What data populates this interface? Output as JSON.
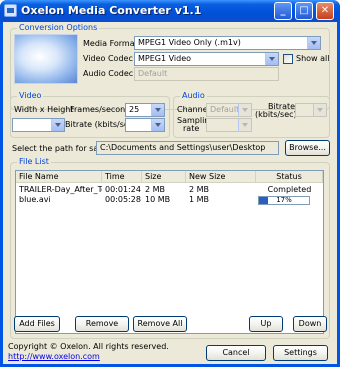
{
  "window": {
    "title": "Oxelon Media Converter v1.1"
  },
  "titlebar_buttons": {
    "minimize": "_",
    "maximize": "□",
    "close": "✕"
  },
  "conversion": {
    "title": "Conversion Options",
    "media_format_label": "Media Format",
    "media_format_value": "MPEG1 Video Only (.m1v)",
    "video_codec_label": "Video Codec",
    "video_codec_value": "MPEG1 Video",
    "show_all_label": "Show all",
    "audio_codec_label": "Audio Codec",
    "audio_codec_value": "Default"
  },
  "video": {
    "title": "Video",
    "width_height_label": "Width x Height",
    "width_height_value": "",
    "fps_label": "Frames/second",
    "fps_value": "25",
    "bitrate_label": "Bitrate (kbits/sec)",
    "bitrate_value": ""
  },
  "audio": {
    "title": "Audio",
    "channels_label": "Channels",
    "channels_value": "Default",
    "bitrate_label_1": "Bitrate",
    "bitrate_label_2": "(kbits/sec)",
    "bitrate_value": "",
    "sampling_label_1": "Sampling",
    "sampling_label_2": "rate",
    "sampling_value": ""
  },
  "save": {
    "label": "Select the path for saving:",
    "path": "C:\\Documents and Settings\\user\\Desktop",
    "browse_label": "Browse..."
  },
  "files": {
    "title": "File List",
    "columns": [
      "File Name",
      "Time",
      "Size",
      "New Size",
      "Status"
    ],
    "rows": [
      {
        "name": "TRAILER-Day_After_To...",
        "time": "00:01:24",
        "size": "2 MB",
        "new_size": "2 MB",
        "status": "Completed"
      },
      {
        "name": "blue.avi",
        "time": "00:05:28",
        "size": "10 MB",
        "new_size": "1 MB",
        "status": "17%",
        "progress": 0.17
      }
    ],
    "add_label": "Add Files",
    "remove_label": "Remove",
    "remove_all_label": "Remove All",
    "up_label": "Up",
    "down_label": "Down"
  },
  "footer": {
    "copyright": "Copyright © Oxelon. All rights reserved.",
    "url": "http://www.oxelon.com",
    "cancel_label": "Cancel",
    "settings_label": "Settings"
  },
  "colors": {
    "accent": "#0046d5",
    "progress": "#2b5fbf",
    "titlebar": "#0050d8"
  }
}
